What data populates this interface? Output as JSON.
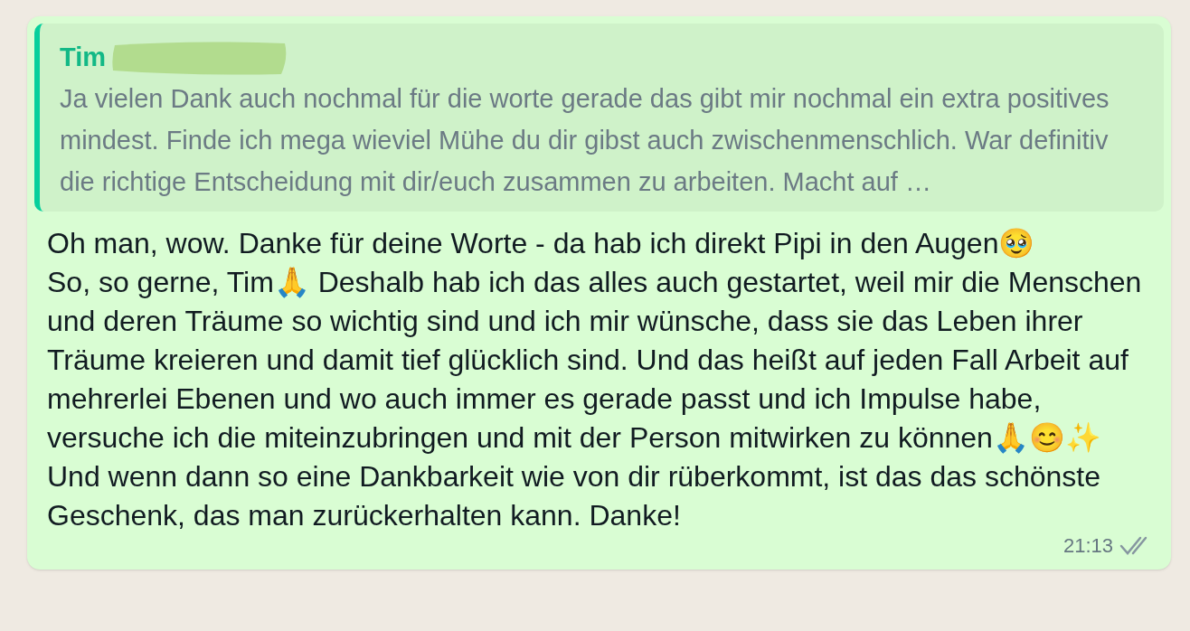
{
  "message": {
    "quote": {
      "sender": "Tim",
      "sender_redacted": true,
      "text": "Ja vielen Dank auch nochmal für die worte gerade das gibt mir nochmal ein extra positives mindest. Finde ich mega wieviel Mühe du dir gibst auch zwischenmenschlich. War definitiv die richtige Entscheidung mit dir/euch zusammen zu arbeiten. Macht auf …"
    },
    "paragraphs": [
      "Oh man, wow. Danke für deine Worte - da hab ich direkt Pipi in den Augen🥹",
      "So, so gerne, Tim🙏 Deshalb hab ich das alles auch gestartet, weil mir die Menschen und deren Träume so wichtig sind und ich mir wünsche, dass sie das Leben ihrer Träume kreieren und damit tief glücklich sind. Und das heißt auf jeden Fall Arbeit auf mehrerlei Ebenen und wo auch immer es gerade passt und ich Impulse habe, versuche ich die miteinzubringen und mit der Person mitwirken zu können🙏😊✨",
      "Und wenn dann so eine Dankbarkeit wie von dir rüberkommt, ist das das schönste Geschenk, das man zurückerhalten kann. Danke!"
    ],
    "time": "21:13",
    "read": false
  }
}
